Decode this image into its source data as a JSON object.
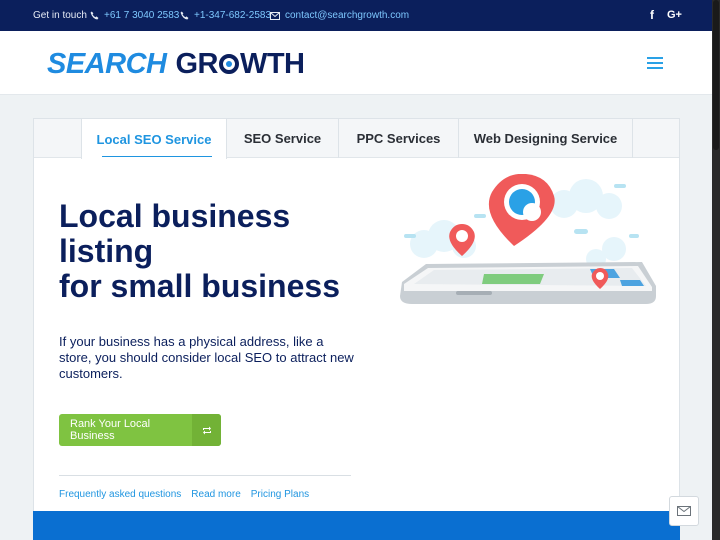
{
  "topbar": {
    "intro": "Get in touch",
    "phone_au": "+61 7 3040 2583",
    "phone_us": "+1-347-682-2583",
    "email": "contact@searchgrowth.com",
    "social": [
      "facebook-icon",
      "google-plus-icon"
    ]
  },
  "header": {
    "logo_part1": "SEARCH",
    "logo_part2_a": "GR",
    "logo_part2_b": "WTH"
  },
  "tabs": [
    {
      "label": "Local SEO Service",
      "active": true
    },
    {
      "label": "SEO Service",
      "active": false
    },
    {
      "label": "PPC Services",
      "active": false
    },
    {
      "label": "Web Designing Service",
      "active": false
    }
  ],
  "hero": {
    "headline_line1": "Local business",
    "headline_line2": "listing",
    "headline_line3": "for small business",
    "description": "If your business has a physical address, like a store, you should consider local SEO to attract new customers.",
    "cta_label": "Rank Your Local Business"
  },
  "links": [
    "Frequently asked questions",
    "Read more",
    "Pricing Plans"
  ],
  "colors": {
    "navy": "#0b1f5c",
    "accent_blue": "#1f95e0",
    "green": "#7fc341",
    "band_blue": "#0a6fd1"
  }
}
